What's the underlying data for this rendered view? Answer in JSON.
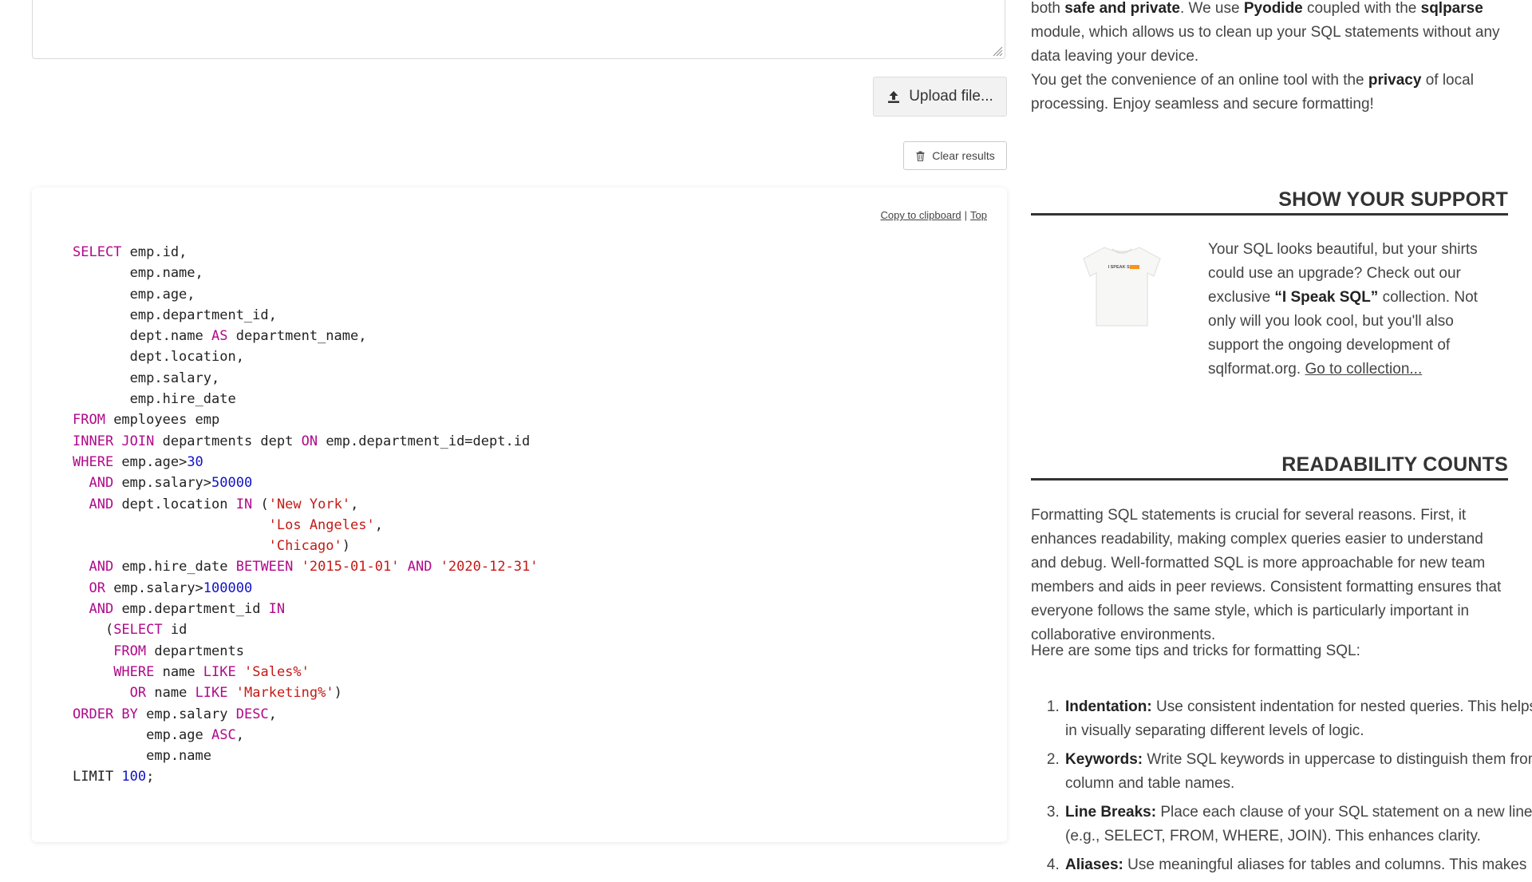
{
  "upload": {
    "label": "Upload file..."
  },
  "clear": {
    "label": "Clear results"
  },
  "result": {
    "copy_label": "Copy to clipboard",
    "sep": "|",
    "top_label": "Top"
  },
  "code_lines": [
    [
      [
        "kw",
        "SELECT"
      ],
      [
        "t",
        " emp.id,"
      ]
    ],
    [
      [
        "t",
        "       emp.name,"
      ]
    ],
    [
      [
        "t",
        "       emp.age,"
      ]
    ],
    [
      [
        "t",
        "       emp.department_id,"
      ]
    ],
    [
      [
        "t",
        "       dept.name "
      ],
      [
        "kw",
        "AS"
      ],
      [
        "t",
        " department_name,"
      ]
    ],
    [
      [
        "t",
        "       dept.location,"
      ]
    ],
    [
      [
        "t",
        "       emp.salary,"
      ]
    ],
    [
      [
        "t",
        "       emp.hire_date"
      ]
    ],
    [
      [
        "kw",
        "FROM"
      ],
      [
        "t",
        " employees emp"
      ]
    ],
    [
      [
        "kw",
        "INNER JOIN"
      ],
      [
        "t",
        " departments dept "
      ],
      [
        "kw",
        "ON"
      ],
      [
        "t",
        " emp.department_id=dept.id"
      ]
    ],
    [
      [
        "kw",
        "WHERE"
      ],
      [
        "t",
        " emp.age>"
      ],
      [
        "num",
        "30"
      ]
    ],
    [
      [
        "t",
        "  "
      ],
      [
        "kw",
        "AND"
      ],
      [
        "t",
        " emp.salary>"
      ],
      [
        "num",
        "50000"
      ]
    ],
    [
      [
        "t",
        "  "
      ],
      [
        "kw",
        "AND"
      ],
      [
        "t",
        " dept.location "
      ],
      [
        "kw",
        "IN"
      ],
      [
        "t",
        " ("
      ],
      [
        "str",
        "'New York'"
      ],
      [
        "t",
        ","
      ]
    ],
    [
      [
        "t",
        "                        "
      ],
      [
        "str",
        "'Los Angeles'"
      ],
      [
        "t",
        ","
      ]
    ],
    [
      [
        "t",
        "                        "
      ],
      [
        "str",
        "'Chicago'"
      ],
      [
        "t",
        ")"
      ]
    ],
    [
      [
        "t",
        "  "
      ],
      [
        "kw",
        "AND"
      ],
      [
        "t",
        " emp.hire_date "
      ],
      [
        "kw",
        "BETWEEN"
      ],
      [
        "t",
        " "
      ],
      [
        "str",
        "'2015-01-01'"
      ],
      [
        "t",
        " "
      ],
      [
        "kw",
        "AND"
      ],
      [
        "t",
        " "
      ],
      [
        "str",
        "'2020-12-31'"
      ]
    ],
    [
      [
        "t",
        "  "
      ],
      [
        "kw",
        "OR"
      ],
      [
        "t",
        " emp.salary>"
      ],
      [
        "num",
        "100000"
      ]
    ],
    [
      [
        "t",
        "  "
      ],
      [
        "kw",
        "AND"
      ],
      [
        "t",
        " emp.department_id "
      ],
      [
        "kw",
        "IN"
      ]
    ],
    [
      [
        "t",
        "    ("
      ],
      [
        "kw",
        "SELECT"
      ],
      [
        "t",
        " id"
      ]
    ],
    [
      [
        "t",
        "     "
      ],
      [
        "kw",
        "FROM"
      ],
      [
        "t",
        " departments"
      ]
    ],
    [
      [
        "t",
        "     "
      ],
      [
        "kw",
        "WHERE"
      ],
      [
        "t",
        " name "
      ],
      [
        "kw",
        "LIKE"
      ],
      [
        "t",
        " "
      ],
      [
        "str",
        "'Sales%'"
      ]
    ],
    [
      [
        "t",
        "       "
      ],
      [
        "kw",
        "OR"
      ],
      [
        "t",
        " name "
      ],
      [
        "kw",
        "LIKE"
      ],
      [
        "t",
        " "
      ],
      [
        "str",
        "'Marketing%'"
      ],
      [
        "t",
        ")"
      ]
    ],
    [
      [
        "kw",
        "ORDER BY"
      ],
      [
        "t",
        " emp.salary "
      ],
      [
        "kw",
        "DESC"
      ],
      [
        "t",
        ","
      ]
    ],
    [
      [
        "t",
        "         emp.age "
      ],
      [
        "kw",
        "ASC"
      ],
      [
        "t",
        ","
      ]
    ],
    [
      [
        "t",
        "         emp.name"
      ]
    ],
    [
      [
        "t",
        "LIMIT "
      ],
      [
        "num",
        "100"
      ],
      [
        "t",
        ";"
      ]
    ]
  ],
  "intro": {
    "p1_a": "both ",
    "p1_b": "safe and private",
    "p1_c": ". We use ",
    "p1_d": "Pyodide",
    "p1_e": " coupled with the ",
    "p1_f": "sqlparse",
    "p1_g": " module, which allows us to clean up your SQL statements without any data leaving your device.",
    "p2_a": "You get the convenience of an online tool with the ",
    "p2_b": "privacy",
    "p2_c": " of local processing. Enjoy seamless and secure formatting!"
  },
  "support": {
    "heading": "SHOW YOUR SUPPORT",
    "shirt_text": "I SPEAK SQL",
    "text_a": "Your SQL looks beautiful, but your shirts could use an upgrade? Check out our exclusive ",
    "text_b": "“I Speak SQL”",
    "text_c": " collection. Not only will you look cool, but you'll also support the ongoing development of sqlformat.org. ",
    "link": "Go to collection..."
  },
  "readability": {
    "heading": "READABILITY COUNTS",
    "p1": "Formatting SQL statements is crucial for several reasons. First, it enhances readability, making complex queries easier to understand and debug. Well-formatted SQL is more approachable for new team members and aids in peer reviews. Consistent formatting ensures that everyone follows the same style, which is particularly important in collaborative environments.",
    "p2": "Here are some tips and tricks for formatting SQL:",
    "tips": [
      {
        "term": "Indentation:",
        "text": " Use consistent indentation for nested queries. This helps in visually separating different levels of logic."
      },
      {
        "term": "Keywords:",
        "text": " Write SQL keywords in uppercase to distinguish them from column and table names."
      },
      {
        "term": "Line Breaks:",
        "text": " Place each clause of your SQL statement on a new line (e.g., SELECT, FROM, WHERE, JOIN). This enhances clarity."
      },
      {
        "term": "Aliases:",
        "text": " Use meaningful aliases for tables and columns. This makes"
      }
    ]
  },
  "colors": {
    "keyword": "#b00a8a",
    "number": "#1212c8",
    "string": "#c41a16",
    "accent": "#f7941d"
  }
}
